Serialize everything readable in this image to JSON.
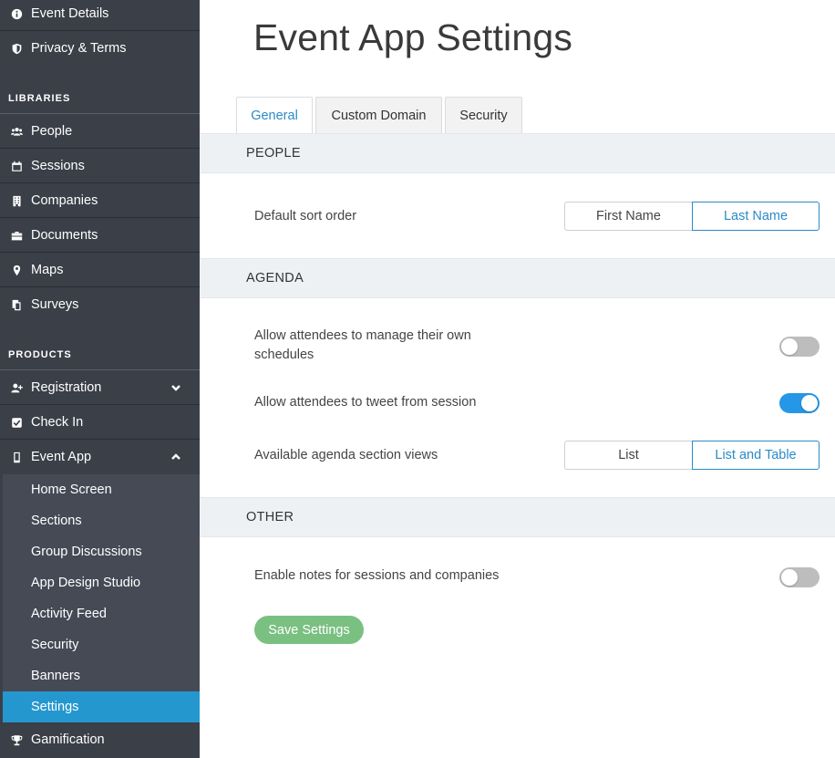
{
  "sidebar": {
    "top_items": [
      {
        "label": "Event Details",
        "icon": "info-icon"
      },
      {
        "label": "Privacy & Terms",
        "icon": "shield-icon"
      }
    ],
    "libraries_heading": "LIBRARIES",
    "libraries": [
      {
        "label": "People",
        "icon": "people-icon"
      },
      {
        "label": "Sessions",
        "icon": "calendar-icon"
      },
      {
        "label": "Companies",
        "icon": "building-icon"
      },
      {
        "label": "Documents",
        "icon": "briefcase-icon"
      },
      {
        "label": "Maps",
        "icon": "map-pin-icon"
      },
      {
        "label": "Surveys",
        "icon": "survey-icon"
      }
    ],
    "products_heading": "PRODUCTS",
    "products": [
      {
        "label": "Registration",
        "icon": "user-plus-icon",
        "chevron": "down"
      },
      {
        "label": "Check In",
        "icon": "check-square-icon"
      },
      {
        "label": "Event App",
        "icon": "mobile-icon",
        "chevron": "up"
      }
    ],
    "event_app_items": [
      {
        "label": "Home Screen"
      },
      {
        "label": "Sections"
      },
      {
        "label": "Group Discussions"
      },
      {
        "label": "App Design Studio"
      },
      {
        "label": "Activity Feed"
      },
      {
        "label": "Security"
      },
      {
        "label": "Banners"
      },
      {
        "label": "Settings",
        "active": true
      }
    ],
    "bottom_items": [
      {
        "label": "Gamification",
        "icon": "trophy-icon"
      }
    ]
  },
  "main": {
    "title": "Event App Settings",
    "tabs": [
      {
        "label": "General",
        "active": true
      },
      {
        "label": "Custom Domain"
      },
      {
        "label": "Security"
      }
    ],
    "sections": {
      "people": {
        "title": "PEOPLE",
        "sort_label": "Default sort order",
        "sort_options": [
          "First Name",
          "Last Name"
        ],
        "sort_selected": "Last Name"
      },
      "agenda": {
        "title": "AGENDA",
        "manage_label": "Allow attendees to manage their own schedules",
        "manage_on": false,
        "tweet_label": "Allow attendees to tweet from session",
        "tweet_on": true,
        "views_label": "Available agenda section views",
        "views_options": [
          "List",
          "List and Table"
        ],
        "views_selected": "List and Table"
      },
      "other": {
        "title": "OTHER",
        "notes_label": "Enable notes for sessions and companies",
        "notes_on": false
      }
    },
    "save_label": "Save Settings"
  },
  "colors": {
    "sidebar_bg": "#3a3f48",
    "submenu_bg": "#454a55",
    "active_bg": "#2597cf",
    "accent": "#2a8ac7",
    "toggle_on": "#2597e6",
    "save_button": "#7ac081"
  }
}
